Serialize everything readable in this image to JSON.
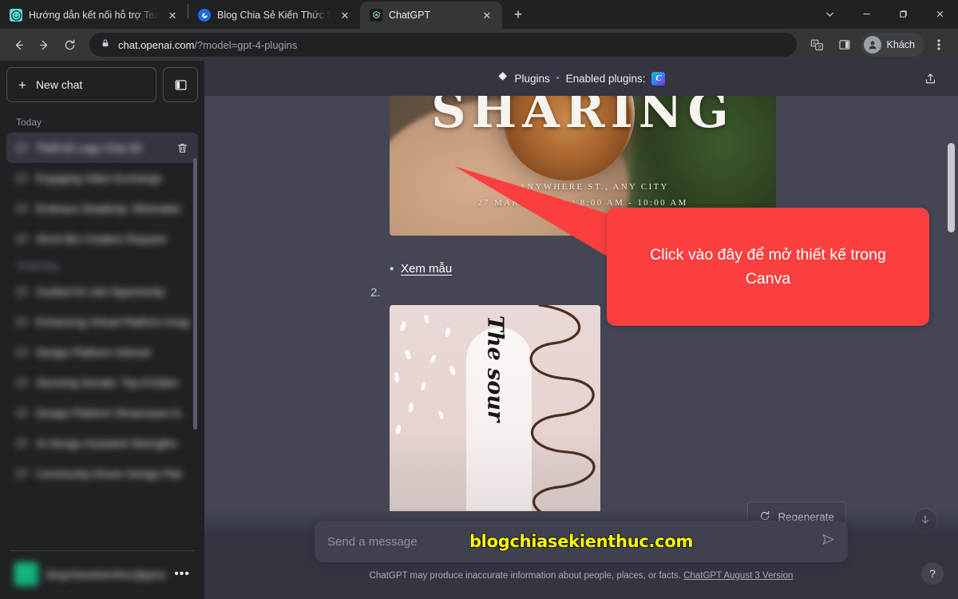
{
  "browser": {
    "tabs": [
      {
        "title": "Hướng dẫn kết nối hỗ trợ Teamvi",
        "favicon": "teamviewer-icon",
        "active": false
      },
      {
        "title": "Blog Chia Sẻ Kiến Thức Store - Sh",
        "favicon": "blog-icon",
        "active": false
      },
      {
        "title": "ChatGPT",
        "favicon": "chatgpt-icon",
        "active": true
      }
    ],
    "new_tab_label": "+",
    "window_controls": {
      "minimize_all": "⌄",
      "minimize": "—",
      "maximize": "❐",
      "close": "✕"
    },
    "nav": {
      "back": "←",
      "forward": "→",
      "reload": "⟳"
    },
    "omnibox": {
      "lock_icon": "lock-icon",
      "url_host": "chat.openai.com",
      "url_path": "/?model=gpt-4-plugins"
    },
    "toolbar_right": {
      "translate_icon": "translate-icon",
      "sidepanel_icon": "side-panel-icon",
      "profile_label": "Khách",
      "menu_icon": "three-dot-menu-icon"
    }
  },
  "sidebar": {
    "new_chat_label": "New chat",
    "collapse_icon": "collapse-sidebar-icon",
    "groups": [
      {
        "label": "Today",
        "items": [
          {
            "label": "Thiết kế Logo Chia Sẻ",
            "redacted": true,
            "selected": true,
            "has_trash": true
          },
          {
            "label": "Engaging Video Exchange",
            "redacted": true,
            "selected": false
          },
          {
            "label": "Embrace Simplicity: Minimalist",
            "redacted": true,
            "selected": false,
            "tail": "list"
          },
          {
            "label": "Short Bio Creation Request",
            "redacted": true,
            "selected": false
          }
        ]
      },
      {
        "label": "Yesterday",
        "items": [
          {
            "label": "Guided Art Job Opportunity",
            "redacted": true,
            "selected": false
          },
          {
            "label": "Enhancing Virtual Platform Imag",
            "redacted": true,
            "selected": false,
            "tail": "ag"
          },
          {
            "label": "Design Platform Interest",
            "redacted": true,
            "selected": false
          },
          {
            "label": "Stunning Socials: Top 8 Editor",
            "redacted": true,
            "selected": false,
            "tail": "or"
          },
          {
            "label": "Design Platform Showcases In",
            "redacted": true,
            "selected": false,
            "tail": "s In"
          },
          {
            "label": "AI Design Assistant Strengths",
            "redacted": true,
            "selected": false,
            "tail": "hs"
          },
          {
            "label": "Community Driven Design Plat",
            "redacted": true,
            "selected": false,
            "tail": "Plat"
          }
        ]
      }
    ],
    "account": {
      "email": "blogchiasekienthuc@gmail.com",
      "redacted": true,
      "menu_icon": "three-dot-menu-icon"
    }
  },
  "chat_header": {
    "plugins_icon": "puzzle-piece-icon",
    "plugins_label": "Plugins",
    "separator": "•",
    "enabled_label": "Enabled plugins:",
    "plugin_badge": "C",
    "plugin_badge_name": "canva-plugin-icon",
    "share_icon": "share-upload-icon"
  },
  "message": {
    "image_1": {
      "name": "coffee-sharing-flyer",
      "headline": "SHARING",
      "address_line": "123 ANYWHERE ST., ANY CITY",
      "date_line": "27 MARCH, 2022 | 8:00 AM - 10:00 AM"
    },
    "bullet_marker": "▪",
    "link_label": "Xem mẫu",
    "list_number": "2.",
    "image_2": {
      "name": "the-source-pink-design",
      "text": "The sour"
    }
  },
  "callout": {
    "text": "Click vào đây để mở thiết kế trong Canva",
    "color": "#fa3f3f"
  },
  "actions": {
    "regenerate_label": "Regenerate",
    "regenerate_icon": "refresh-icon",
    "scroll_down_icon": "arrow-down-icon"
  },
  "composer": {
    "placeholder": "Send a message",
    "value": "",
    "send_icon": "send-arrow-icon",
    "watermark": "blogchiasekienthuc.com"
  },
  "footer": {
    "disclaimer": "ChatGPT may produce inaccurate information about people, places, or facts.",
    "version_link": "ChatGPT August 3 Version",
    "help_label": "?"
  }
}
